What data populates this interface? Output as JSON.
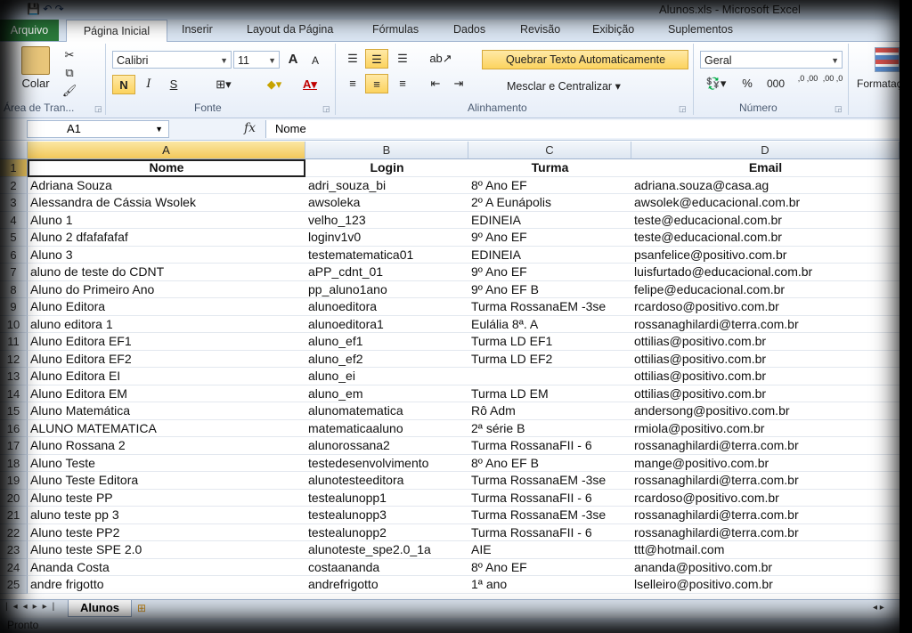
{
  "window": {
    "title": "Alunos.xls - Microsoft Excel",
    "quick_access": "💾 ↶ ↷"
  },
  "tabs": [
    "Arquivo",
    "Página Inicial",
    "Inserir",
    "Layout da Página",
    "Fórmulas",
    "Dados",
    "Revisão",
    "Exibição",
    "Suplementos"
  ],
  "ribbon": {
    "clipboard": {
      "paste_label": "Colar",
      "group_label": "Área de Tran..."
    },
    "font": {
      "name": "Calibri",
      "size": "11",
      "grow": "A",
      "shrink": "A",
      "bold": "N",
      "italic": "I",
      "underline": "S",
      "group_label": "Fonte"
    },
    "alignment": {
      "wrap_text": "Quebrar Texto Automaticamente",
      "merge_center": "Mesclar e Centralizar",
      "group_label": "Alinhamento"
    },
    "number": {
      "format": "Geral",
      "percent": "%",
      "thousands": "000",
      "inc_decimal": ",0 ,00",
      "dec_decimal": ",00 ,0",
      "group_label": "Número"
    },
    "styles": {
      "conditional_format": "Formatação Condicional"
    }
  },
  "formula_bar": {
    "cell_ref": "A1",
    "fx": "fx",
    "content": "Nome"
  },
  "columns": [
    "A",
    "B",
    "C",
    "D"
  ],
  "header_row": [
    "Nome",
    "Login",
    "Turma",
    "Email"
  ],
  "rows": [
    [
      "Adriana Souza",
      "adri_souza_bi",
      "8º Ano EF",
      "adriana.souza@casa.ag"
    ],
    [
      "Alessandra de Cássia Wsolek",
      "awsoleka",
      "2º A Eunápolis",
      "awsolek@educacional.com.br"
    ],
    [
      "Aluno 1",
      "velho_123",
      "EDINEIA",
      "teste@educacional.com.br"
    ],
    [
      "Aluno 2 dfafafafaf",
      "loginv1v0",
      "9º Ano EF",
      "teste@educacional.com.br"
    ],
    [
      "Aluno 3",
      "testematematica01",
      "EDINEIA",
      "psanfelice@positivo.com.br"
    ],
    [
      "aluno de teste do CDNT",
      "aPP_cdnt_01",
      "9º Ano EF",
      "luisfurtado@educacional.com.br"
    ],
    [
      "Aluno do Primeiro Ano",
      "pp_aluno1ano",
      "9º Ano EF B",
      "felipe@educacional.com.br"
    ],
    [
      "Aluno Editora",
      "alunoeditora",
      "Turma RossanaEM -3se",
      "rcardoso@positivo.com.br"
    ],
    [
      "aluno editora 1",
      "alunoeditora1",
      "Eulália 8ª. A",
      "rossanaghilardi@terra.com.br"
    ],
    [
      "Aluno Editora EF1",
      "aluno_ef1",
      "Turma LD EF1",
      "ottilias@positivo.com.br"
    ],
    [
      "Aluno Editora EF2",
      "aluno_ef2",
      "Turma LD EF2",
      "ottilias@positivo.com.br"
    ],
    [
      "Aluno Editora EI",
      "aluno_ei",
      "",
      "ottilias@positivo.com.br"
    ],
    [
      "Aluno Editora EM",
      "aluno_em",
      "Turma LD EM",
      "ottilias@positivo.com.br"
    ],
    [
      "Aluno Matemática",
      "alunomatematica",
      "Rô Adm",
      "andersong@positivo.com.br"
    ],
    [
      "ALUNO MATEMATICA",
      "matematicaaluno",
      "2ª série B",
      "rmiola@positivo.com.br"
    ],
    [
      "Aluno Rossana 2",
      "alunorossana2",
      "Turma RossanaFII - 6",
      "rossanaghilardi@terra.com.br"
    ],
    [
      "Aluno Teste",
      "testedesenvolvimento",
      "8º Ano EF B",
      "mange@positivo.com.br"
    ],
    [
      "Aluno Teste Editora",
      "alunotesteeditora",
      "Turma RossanaEM -3se",
      "rossanaghilardi@terra.com.br"
    ],
    [
      "Aluno teste PP",
      "testealunopp1",
      "Turma RossanaFII - 6",
      "rcardoso@positivo.com.br"
    ],
    [
      "aluno teste pp 3",
      "testealunopp3",
      "Turma RossanaEM -3se",
      "rossanaghilardi@terra.com.br"
    ],
    [
      "Aluno teste PP2",
      "testealunopp2",
      "Turma RossanaFII - 6",
      "rossanaghilardi@terra.com.br"
    ],
    [
      "Aluno teste SPE 2.0",
      "alunoteste_spe2.0_1a",
      "AIE",
      "ttt@hotmail.com"
    ],
    [
      "Ananda Costa",
      "costaananda",
      "8º Ano EF",
      "ananda@positivo.com.br"
    ],
    [
      "andre frigotto",
      "andrefrigotto",
      "1ª ano",
      "lselleiro@positivo.com.br"
    ]
  ],
  "sheet_tab": "Alunos",
  "status": "Pronto"
}
